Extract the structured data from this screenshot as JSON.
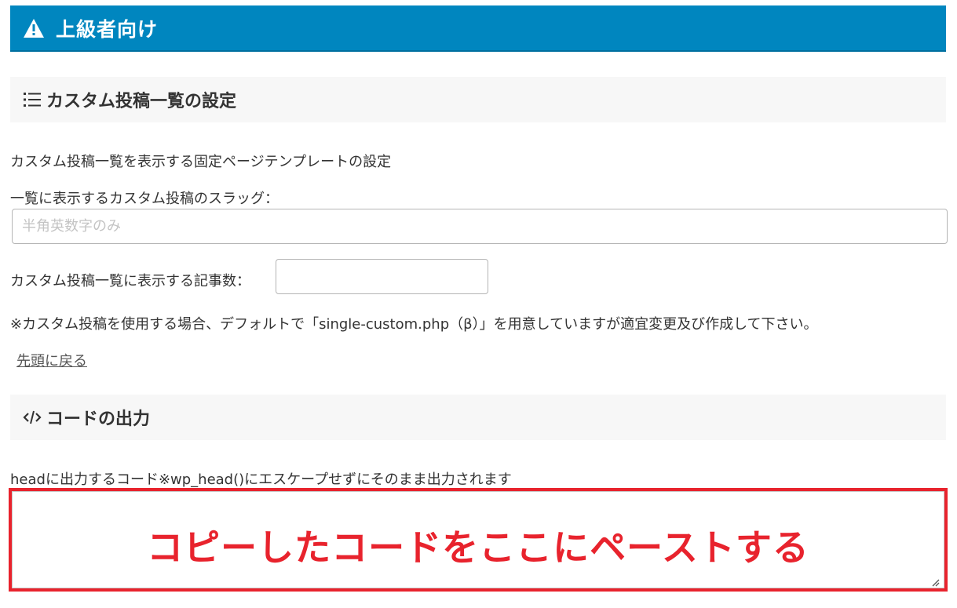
{
  "banner": {
    "title": "上級者向け",
    "icon": "warning-icon",
    "color": "#0086bf"
  },
  "custom_post_section": {
    "heading": "カスタム投稿一覧の設定",
    "icon": "list-icon",
    "description": "カスタム投稿一覧を表示する固定ページテンプレートの設定",
    "slug_label": "一覧に表示するカスタム投稿のスラッグ：",
    "slug_value": "",
    "slug_placeholder": "半角英数字のみ",
    "count_label": "カスタム投稿一覧に表示する記事数：",
    "count_value": "",
    "note": "※カスタム投稿を使用する場合、デフォルトで「single-custom.php（β）」を用意していますが適宜変更及び作成して下さい。",
    "back_to_top": "先頭に戻る"
  },
  "code_section": {
    "heading": "コードの出力",
    "icon": "code-icon",
    "head_label": "headに出力するコード※wp_head()にエスケープせずにそのまま出力されます",
    "head_value": "",
    "overlay_text": "コピーしたコードをここにペーストする",
    "highlight_color": "#e8232d"
  }
}
